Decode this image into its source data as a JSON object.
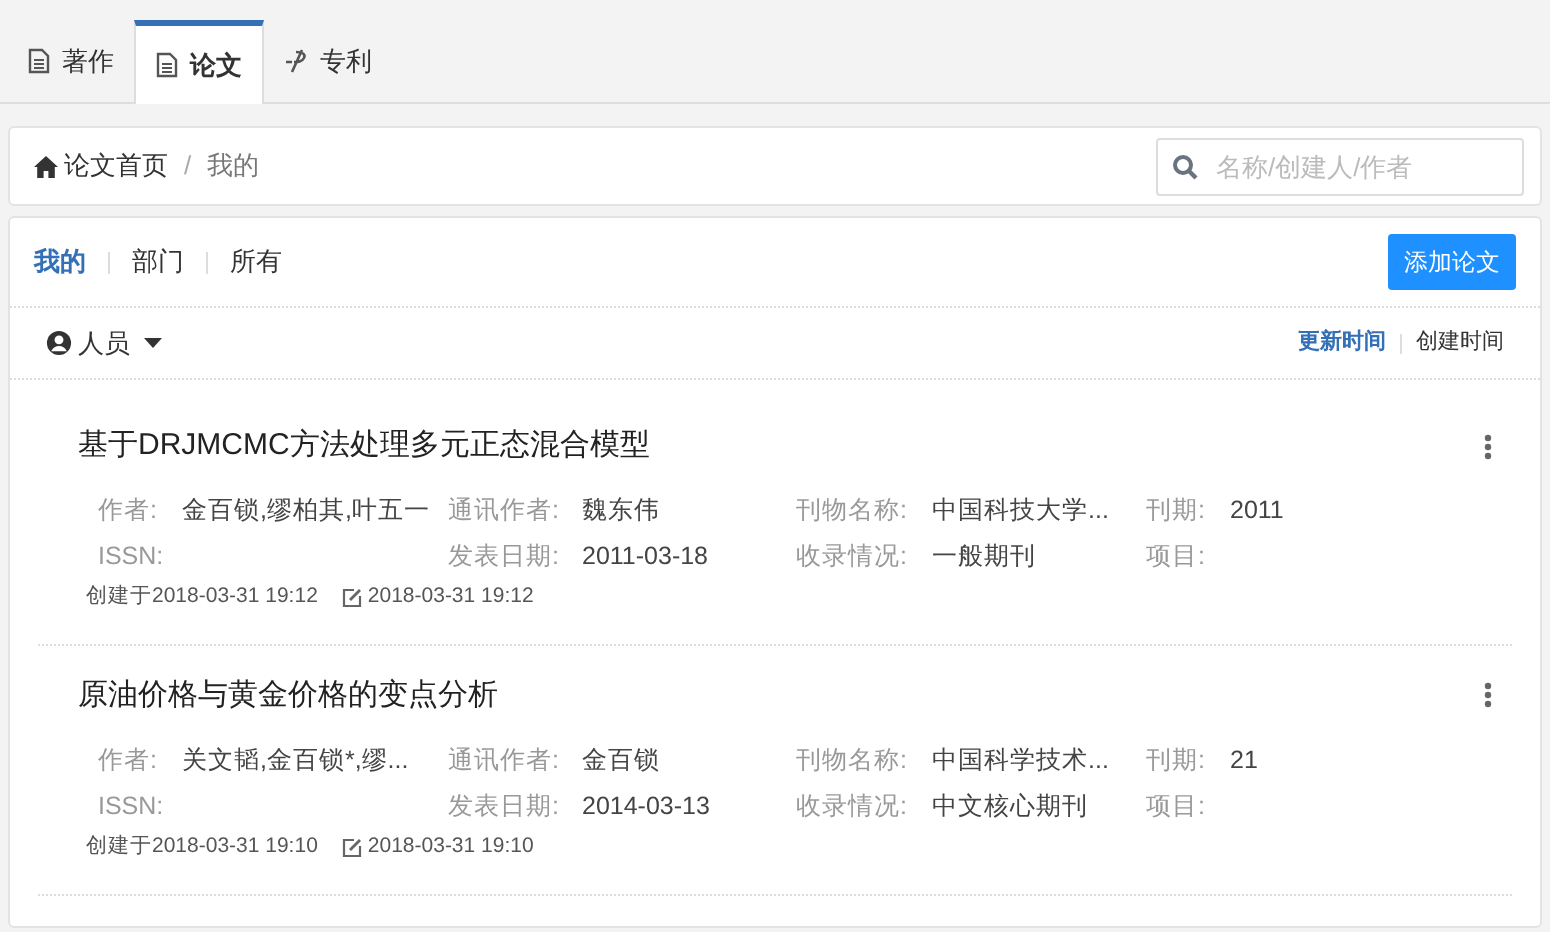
{
  "tabs": [
    {
      "label": "著作",
      "kind": "doc",
      "selected": false
    },
    {
      "label": "论文",
      "kind": "doc",
      "selected": true
    },
    {
      "label": "专利",
      "kind": "patent",
      "selected": false
    }
  ],
  "breadcrumb": {
    "items": [
      "论文首页",
      "我的"
    ],
    "separator": "/"
  },
  "search": {
    "placeholder": "名称/创建人/作者"
  },
  "scope_tabs": [
    {
      "label": "我的",
      "selected": true
    },
    {
      "label": "部门",
      "selected": false
    },
    {
      "label": "所有",
      "selected": false
    }
  ],
  "add_button": "添加论文",
  "person_filter": "人员",
  "sort_options": [
    {
      "label": "更新时间",
      "selected": true
    },
    {
      "label": "创建时间",
      "selected": false
    }
  ],
  "papers": [
    {
      "title": "基于DRJMCMC方法处理多元正态混合模型",
      "fields": [
        {
          "label": "作者:",
          "value": "金百锁,缪柏其,叶五一"
        },
        {
          "label": "通讯作者:",
          "value": "魏东伟"
        },
        {
          "label": "刊物名称:",
          "value": "中国科技大学..."
        },
        {
          "label": "刊期:",
          "value": "2011"
        },
        {
          "label": "ISSN:"
        },
        {
          "label": "发表日期:",
          "value": "2011-03-18"
        },
        {
          "label": "收录情况:",
          "value": "一般期刊"
        },
        {
          "label": "项目:"
        }
      ],
      "created": "创建于2018-03-31 19:12",
      "updated": "2018-03-31 19:12"
    },
    {
      "title": "原油价格与黄金价格的变点分析",
      "fields": [
        {
          "label": "作者:",
          "value": "关文韬,金百锁*,缪..."
        },
        {
          "label": "通讯作者:",
          "value": "金百锁"
        },
        {
          "label": "刊物名称:",
          "value": "中国科学技术..."
        },
        {
          "label": "刊期:",
          "value": "21"
        },
        {
          "label": "ISSN:"
        },
        {
          "label": "发表日期:",
          "value": "2014-03-13"
        },
        {
          "label": "收录情况:",
          "value": "中文核心期刊"
        },
        {
          "label": "项目:"
        }
      ],
      "created": "创建于2018-03-31 19:10",
      "updated": "2018-03-31 19:10"
    }
  ]
}
